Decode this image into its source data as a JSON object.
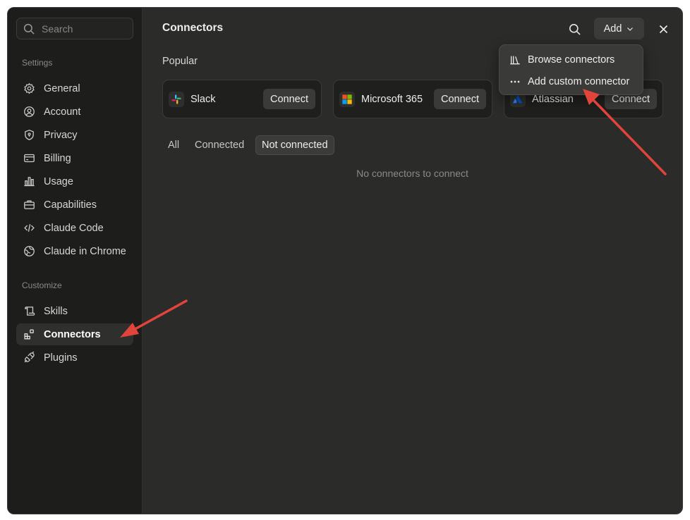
{
  "search": {
    "placeholder": "Search"
  },
  "sidebar": {
    "settings_label": "Settings",
    "settings_items": [
      {
        "label": "General",
        "icon": "gear-icon"
      },
      {
        "label": "Account",
        "icon": "user-circle-icon"
      },
      {
        "label": "Privacy",
        "icon": "shield-icon"
      },
      {
        "label": "Billing",
        "icon": "credit-card-icon"
      },
      {
        "label": "Usage",
        "icon": "bar-chart-icon"
      },
      {
        "label": "Capabilities",
        "icon": "briefcase-icon"
      },
      {
        "label": "Claude Code",
        "icon": "code-icon"
      },
      {
        "label": "Claude in Chrome",
        "icon": "globe-icon"
      }
    ],
    "customize_label": "Customize",
    "customize_items": [
      {
        "label": "Skills",
        "icon": "scroll-icon"
      },
      {
        "label": "Connectors",
        "icon": "connectors-icon",
        "active": true
      },
      {
        "label": "Plugins",
        "icon": "plug-icon"
      }
    ]
  },
  "header": {
    "title": "Connectors",
    "add_label": "Add"
  },
  "popular": {
    "label": "Popular",
    "cards": [
      {
        "name": "Slack",
        "button": "Connect",
        "icon": "slack-logo-icon"
      },
      {
        "name": "Microsoft 365",
        "button": "Connect",
        "icon": "microsoft-logo-icon"
      },
      {
        "name": "Atlassian",
        "button": "Connect",
        "icon": "atlassian-logo-icon"
      }
    ]
  },
  "filters": [
    {
      "label": "All"
    },
    {
      "label": "Connected"
    },
    {
      "label": "Not connected",
      "active": true
    }
  ],
  "empty_state": "No connectors to connect",
  "dropdown": {
    "items": [
      {
        "label": "Browse connectors",
        "icon": "library-icon"
      },
      {
        "label": "Add custom connector",
        "icon": "more-horizontal-icon"
      }
    ]
  },
  "colors": {
    "window_bg": "#2b2b2a",
    "sidebar_bg": "#1d1d1c",
    "annotation_arrow": "#e0443a"
  }
}
